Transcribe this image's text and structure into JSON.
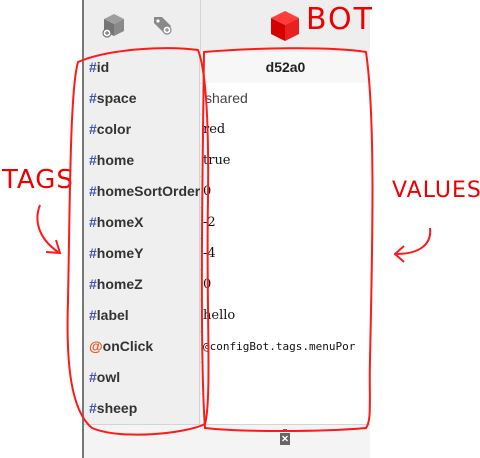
{
  "toolbar": {
    "new_bot_icon": "cube-add-icon",
    "tag_icon": "tag-add-icon",
    "bot_icon": "red-cube-icon",
    "delete_icon": "trash-icon"
  },
  "header": {
    "bot_id": "d52a0"
  },
  "rows": [
    {
      "prefix": "#",
      "tag": "id",
      "value": "d52a0"
    },
    {
      "prefix": "#",
      "tag": "space",
      "value": "shared"
    },
    {
      "prefix": "#",
      "tag": "color",
      "value": "red"
    },
    {
      "prefix": "#",
      "tag": "home",
      "value": "true"
    },
    {
      "prefix": "#",
      "tag": "homeSortOrder",
      "value": "0"
    },
    {
      "prefix": "#",
      "tag": "homeX",
      "value": "-2"
    },
    {
      "prefix": "#",
      "tag": "homeY",
      "value": "-4"
    },
    {
      "prefix": "#",
      "tag": "homeZ",
      "value": "0"
    },
    {
      "prefix": "#",
      "tag": "label",
      "value": "hello"
    },
    {
      "prefix": "@",
      "tag": "onClick",
      "value": "@configBot.tags.menuPor"
    },
    {
      "prefix": "#",
      "tag": "owl",
      "value": ""
    },
    {
      "prefix": "#",
      "tag": "sheep",
      "value": ""
    }
  ],
  "annotations": {
    "bot": "BOT",
    "tags": "TAGS",
    "values": "VALUES"
  },
  "colors": {
    "accent": "#3f51b5",
    "listener": "#f4511e",
    "bot": "#e53935",
    "annotation": "#e00000"
  }
}
